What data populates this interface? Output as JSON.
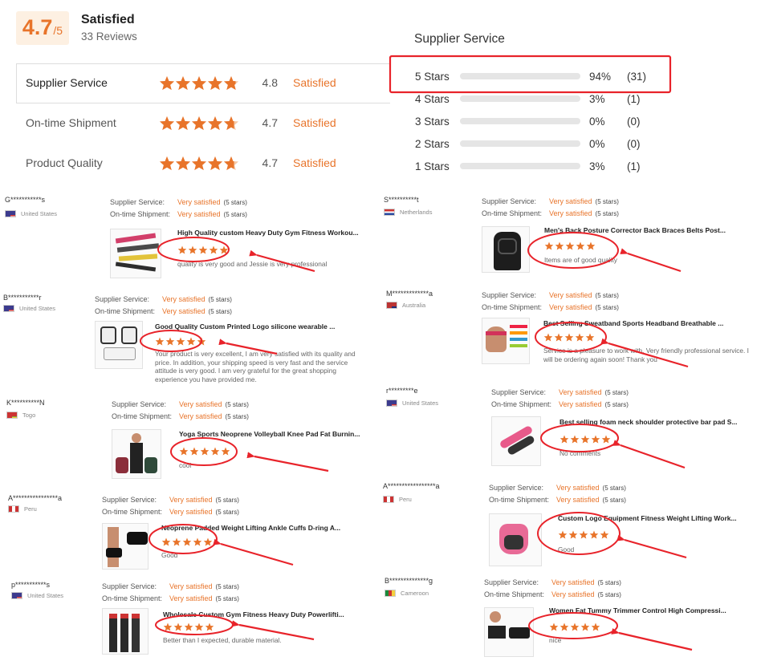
{
  "summary": {
    "score": "4.7",
    "score_max": "/5",
    "title": "Satisfied",
    "reviews_count": "33 Reviews"
  },
  "metrics": [
    {
      "name": "Supplier Service",
      "score": "4.8",
      "status": "Satisfied",
      "rating": 4.8
    },
    {
      "name": "On-time Shipment",
      "score": "4.7",
      "status": "Satisfied",
      "rating": 4.7
    },
    {
      "name": "Product Quality",
      "score": "4.7",
      "status": "Satisfied",
      "rating": 4.7
    }
  ],
  "distribution": {
    "title": "Supplier Service",
    "rows": [
      {
        "label": "5  Stars",
        "pct": "94%",
        "count": "(31)",
        "fill": 0.94
      },
      {
        "label": "4  Stars",
        "pct": "3%",
        "count": "(1)",
        "fill": 0.03
      },
      {
        "label": "3  Stars",
        "pct": "0%",
        "count": "(0)",
        "fill": 0
      },
      {
        "label": "2  Stars",
        "pct": "0%",
        "count": "(0)",
        "fill": 0
      },
      {
        "label": "1  Stars",
        "pct": "3%",
        "count": "(1)",
        "fill": 0.03
      }
    ]
  },
  "labels": {
    "supplier_service": "Supplier Service:",
    "ontime_shipment": "On-time Shipment:",
    "very_satisfied": "Very satisfied",
    "five_stars": "(5 stars)"
  },
  "reviews": [
    {
      "user": "G***********s",
      "country": "United States",
      "product": "High Quality custom Heavy Duty Gym Fitness Workou...",
      "text": "quality is very good and Jessie is very professional"
    },
    {
      "user": "S**********t",
      "country": "Netherlands",
      "product": "Men's Back Posture Corrector Back Braces Belts Post...",
      "text": "Items are of good quality"
    },
    {
      "user": "B***********r",
      "country": "United States",
      "product": "Good Quality Custom Printed Logo silicone wearable ...",
      "text": "Your product is very excellent, I am very satisfied with its quality and price. In addition, your shipping speed is very fast and the service attitude is very good. I am very grateful for the great shopping experience you have provided me."
    },
    {
      "user": "M*************a",
      "country": "Australia",
      "product": "Best Selling Sweatband Sports Headband Breathable ...",
      "text": "Service is a pleasure to work with. Very friendly professional service. I will be ordering again soon! Thank you"
    },
    {
      "user": "K**********N",
      "country": "Togo",
      "product": "Yoga Sports Neoprene Volleyball Knee Pad Fat Burnin...",
      "text": "cool"
    },
    {
      "user": "r*********e",
      "country": "United States",
      "product": "Best selling foam neck shoulder protective bar pad S...",
      "text": "No comments"
    },
    {
      "user": "A****************a",
      "country": "Peru",
      "product": "Neoprene Padded Weight Lifting Ankle Cuffs D-ring A...",
      "text": "Good"
    },
    {
      "user": "A*****************a",
      "country": "Peru",
      "product": "Custom Logo Equipment Fitness Weight Lifting Work...",
      "text": "Good"
    },
    {
      "user": "p***********s",
      "country": "United States",
      "product": "Wholesale Custom Gym Fitness Heavy Duty Powerlifti...",
      "text": "Better than I expected, durable material."
    },
    {
      "user": "B**************g",
      "country": "Cameroon",
      "product": "Women Fat Tummy Trimmer Control High Compressi...",
      "text": "nice"
    }
  ],
  "colors": {
    "accent": "#e8742a",
    "annotation": "#e8232a"
  }
}
